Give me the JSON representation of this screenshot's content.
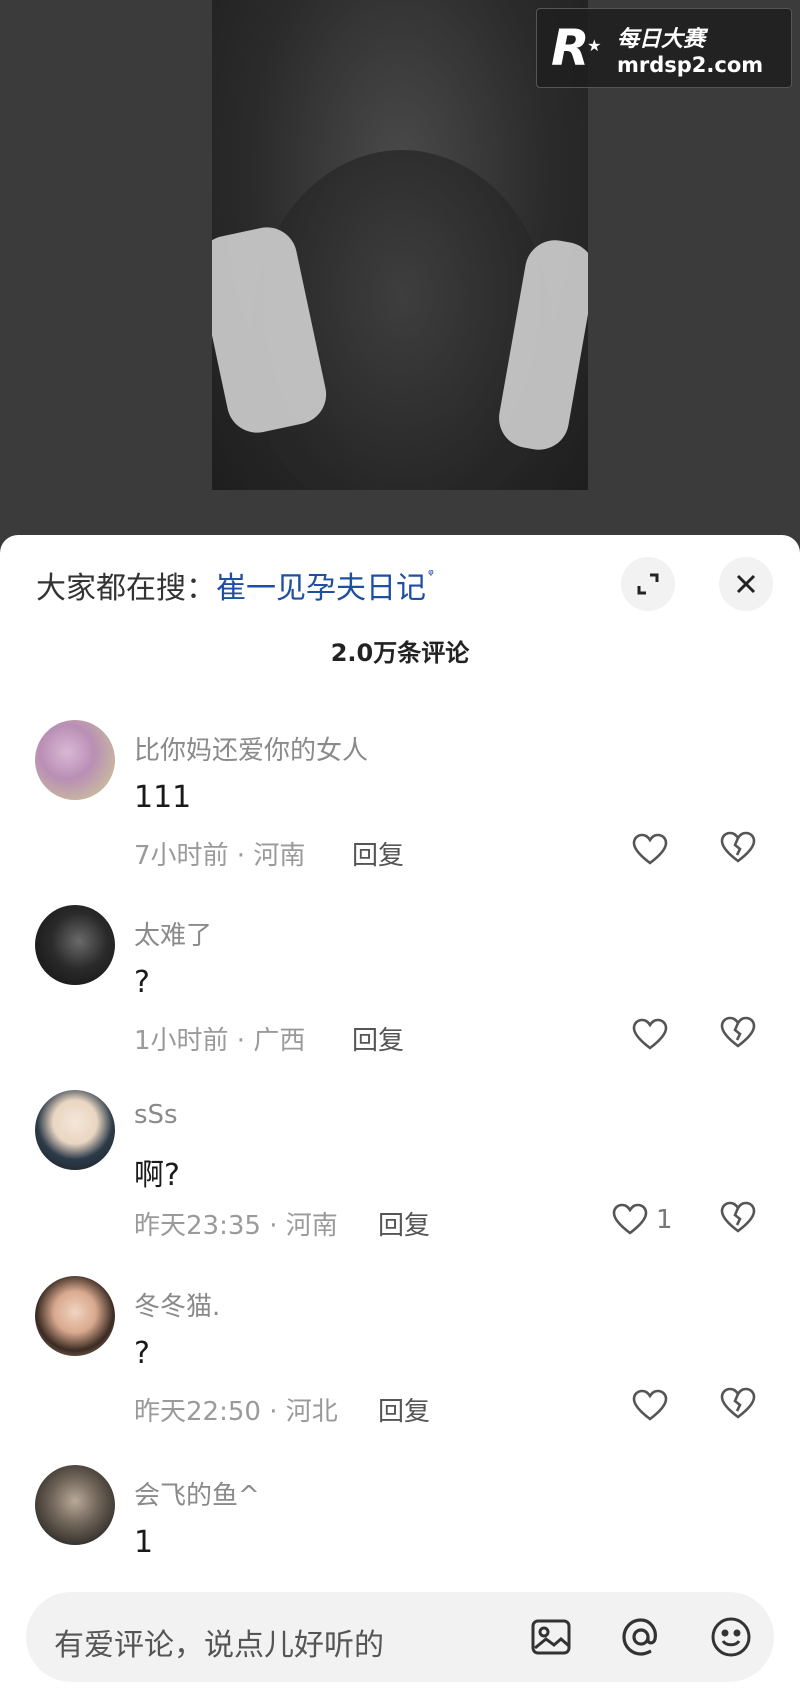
{
  "watermark": {
    "logo": "R",
    "star": "★",
    "title": "每日大赛",
    "url": "mrdsp2.com"
  },
  "panel": {
    "search_prefix": "大家都在搜：",
    "search_term": "崔一见孕夫日记",
    "search_icon": "ᵠ",
    "comment_count": "2.0万条评论"
  },
  "comments": [
    {
      "username": "比你妈还爱你的女人",
      "content": "111",
      "meta": "7小时前 · 河南",
      "reply": "回复",
      "likes": ""
    },
    {
      "username": "太难了",
      "content": "?",
      "meta": "1小时前 · 广西",
      "reply": "回复",
      "likes": ""
    },
    {
      "username": "sSs",
      "content": "啊?",
      "meta": "昨天23:35 · 河南",
      "reply": "回复",
      "likes": "1"
    },
    {
      "username": "冬冬猫.",
      "content": "?",
      "meta": "昨天22:50 · 河北",
      "reply": "回复",
      "likes": ""
    },
    {
      "username": "会飞的鱼^",
      "content": "1",
      "meta": "",
      "reply": "",
      "likes": ""
    }
  ],
  "input": {
    "placeholder": "有爱评论，说点儿好听的"
  },
  "colors": {
    "link": "#1f4fa0",
    "meta": "#9a9a9a",
    "panel_bg": "#ffffff",
    "backdrop": "#3a3a3a"
  },
  "icons": [
    "expand-icon",
    "close-icon",
    "heart-icon",
    "broken-heart-icon",
    "image-icon",
    "at-icon",
    "emoji-icon"
  ]
}
